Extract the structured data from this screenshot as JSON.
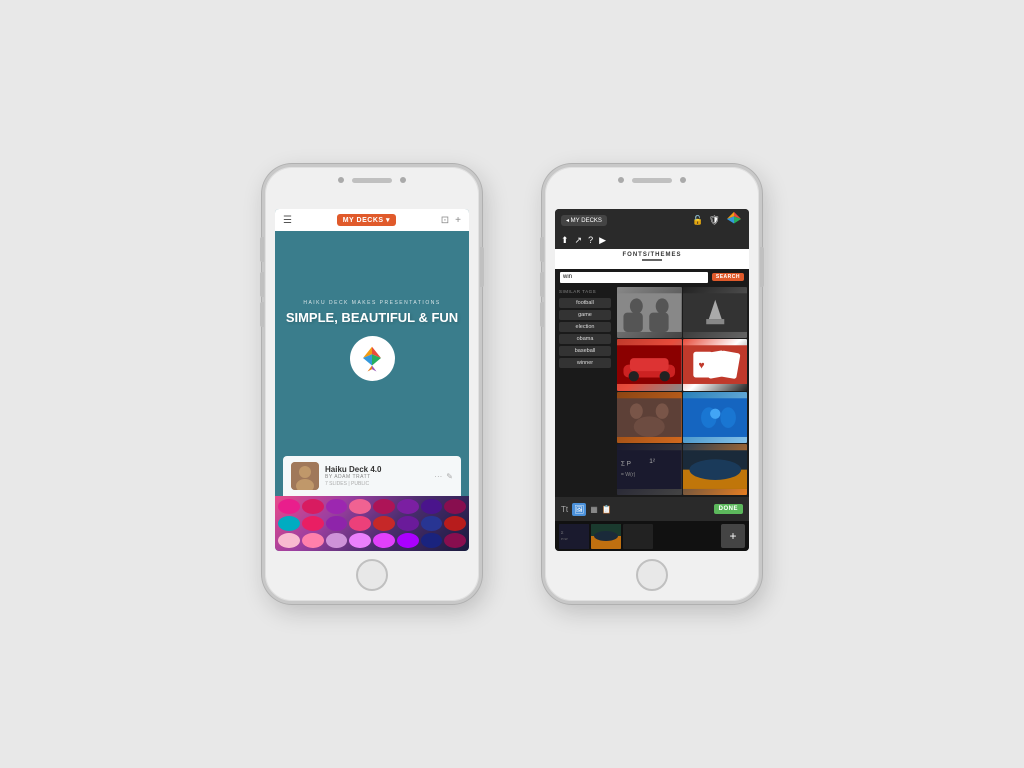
{
  "page": {
    "background": "#e8e8e8"
  },
  "phone1": {
    "topbar": {
      "my_decks_label": "MY DECKS ▾"
    },
    "hero": {
      "subtitle": "HAIKU DECK MAKES PRESENTATIONS",
      "title": "SIMPLE, BEAUTIFUL & FUN"
    },
    "card": {
      "title": "Haiku Deck 4.0",
      "by_label": "BY ADAM TRATT",
      "meta": "7 SLIDES | PUBLIC"
    }
  },
  "phone2": {
    "topbar": {
      "back_label": "◂ MY DECKS"
    },
    "fonts_themes_label": "FONTS/THEMES",
    "search": {
      "value": "win",
      "button_label": "SEARCH"
    },
    "similar_tags_label": "SIMILAR TAGS",
    "tags": [
      "football",
      "game",
      "election",
      "obama",
      "baseball",
      "winner"
    ],
    "toolbar": {
      "done_label": "DONE"
    }
  }
}
